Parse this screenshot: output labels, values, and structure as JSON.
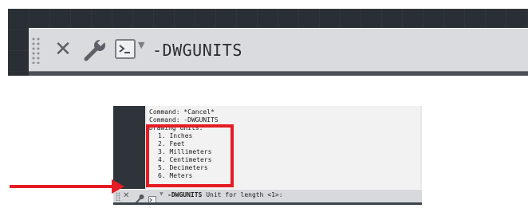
{
  "zoomed_bar": {
    "command_text": "-DWGUNITS",
    "icons": [
      "grip-icon",
      "close-icon",
      "wrench-icon",
      "prompt-icon",
      "dropdown-caret-icon"
    ]
  },
  "history": {
    "lines": [
      "Command: *Cancel*",
      "Command: -DWGUNITS",
      "Drawing units:"
    ],
    "units": [
      "1. Inches",
      "2. Feet",
      "3. Millimeters",
      "4. Centimeters",
      "5. Decimeters",
      "6. Meters"
    ]
  },
  "command_line": {
    "command": "-DWGUNITS",
    "prompt": "Unit for length <1>:"
  },
  "colors": {
    "highlight": "#e51c23",
    "bar": "#d9dbde",
    "dark": "#2a2e35"
  }
}
